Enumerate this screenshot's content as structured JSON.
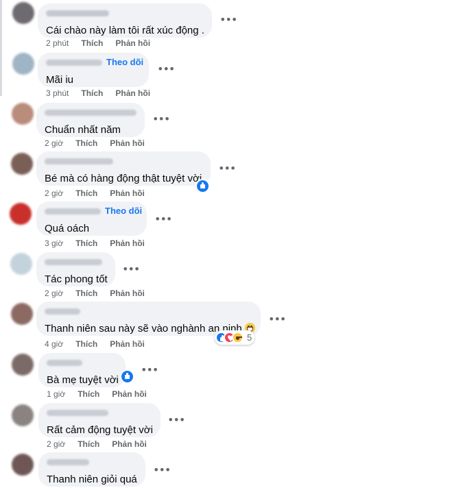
{
  "comments": [
    {
      "text": "Cái chào này làm tôi rất xúc động .",
      "time": "2 phút",
      "follow": "",
      "avatar_color": "#6d6a70",
      "name_color": "#c5c8d0"
    },
    {
      "text": "Mãi iu",
      "time": "3 phút",
      "follow": "Theo dõi",
      "avatar_color": "#9fb4c4",
      "name_color": "#c9ccd3"
    },
    {
      "text": "Chuẩn nhất năm",
      "time": "2 giờ",
      "follow": "",
      "avatar_color": "#b98c7c",
      "name_color": "#c9ccd3"
    },
    {
      "text": "Bé mà có hàng động thật tuyệt vời",
      "time": "2 giờ",
      "follow": "",
      "avatar_color": "#7a5f56",
      "name_color": "#c9ccd3"
    },
    {
      "text": "Quá oách",
      "time": "3 giờ",
      "follow": "Theo dõi",
      "avatar_color": "#c9302c",
      "name_color": "#c9ccd3"
    },
    {
      "text": "Tác phong tốt",
      "time": "2 giờ",
      "follow": "",
      "avatar_color": "#c3d3dc",
      "name_color": "#c9ccd3"
    },
    {
      "text": "Thanh niên sau này sẽ vào nghành an ninh",
      "time": "4 giờ",
      "follow": "",
      "avatar_color": "#8c6a63",
      "name_color": "#c9ccd3",
      "reaction_count": "5"
    },
    {
      "text": "Bà mẹ tuyệt vời",
      "time": "1 giờ",
      "follow": "",
      "avatar_color": "#7b6b68",
      "name_color": "#c9ccd3"
    },
    {
      "text": "Rất cảm động tuyệt vời",
      "time": "2 giờ",
      "follow": "",
      "avatar_color": "#8a8380",
      "name_color": "#c9ccd3"
    },
    {
      "text": "Thanh niên giỏi quá",
      "time": "",
      "follow": "",
      "avatar_color": "#6e5656",
      "name_color": "#c9ccd3"
    }
  ],
  "actions": {
    "like": "Thích",
    "reply": "Phản hồi"
  },
  "more_icon": "•••",
  "icons": {
    "more": "more-horizontal-icon",
    "like": "like-reaction-icon",
    "heart": "love-reaction-icon",
    "haha": "haha-reaction-icon",
    "grin": "grinning-emoji-icon"
  }
}
